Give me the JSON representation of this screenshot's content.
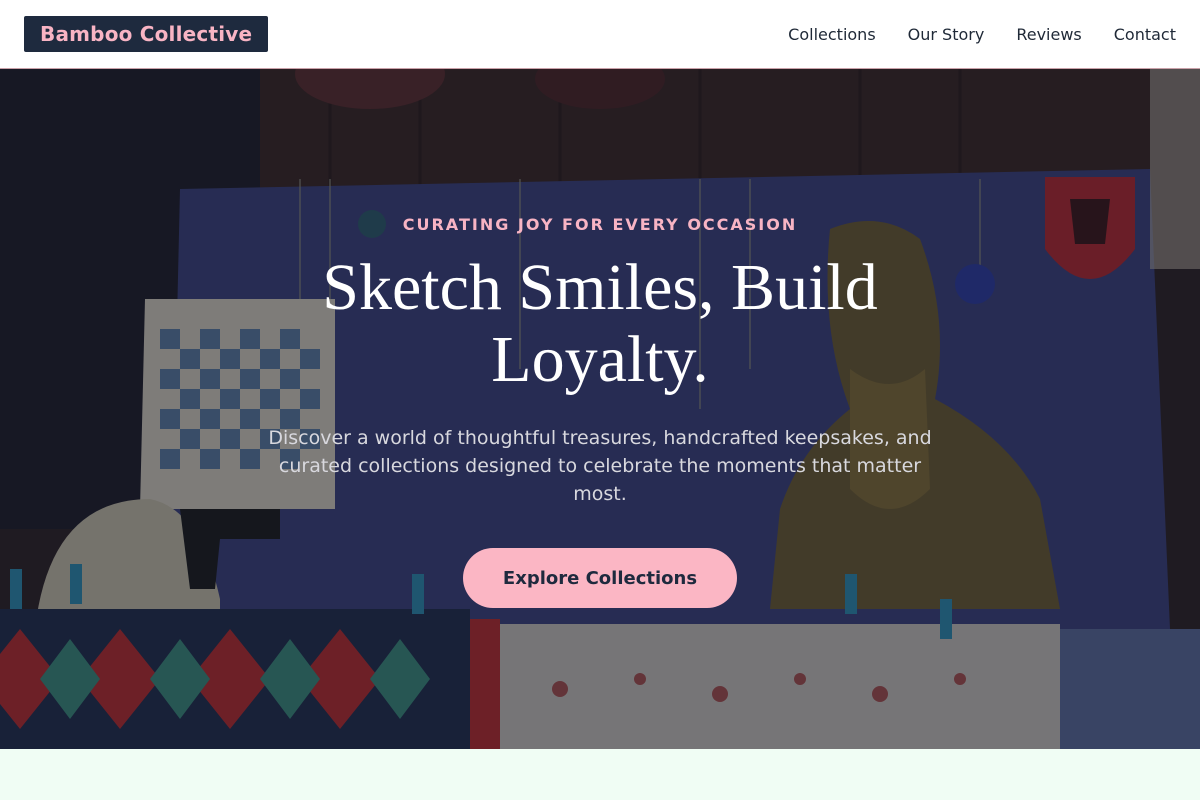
{
  "header": {
    "logo": "Bamboo Collective",
    "nav": [
      "Collections",
      "Our Story",
      "Reviews",
      "Contact"
    ]
  },
  "hero": {
    "eyebrow": "CURATING JOY FOR EVERY OCCASION",
    "headline": "Sketch Smiles, Build Loyalty.",
    "subtext": "Discover a world of thoughtful treasures, handcrafted keepsakes, and curated collections designed to celebrate the moments that matter most.",
    "cta": "Explore Collections"
  },
  "colors": {
    "accent": "#fbb6c4",
    "navy": "#1e2a3e",
    "footer_band": "#f0fdf4"
  }
}
